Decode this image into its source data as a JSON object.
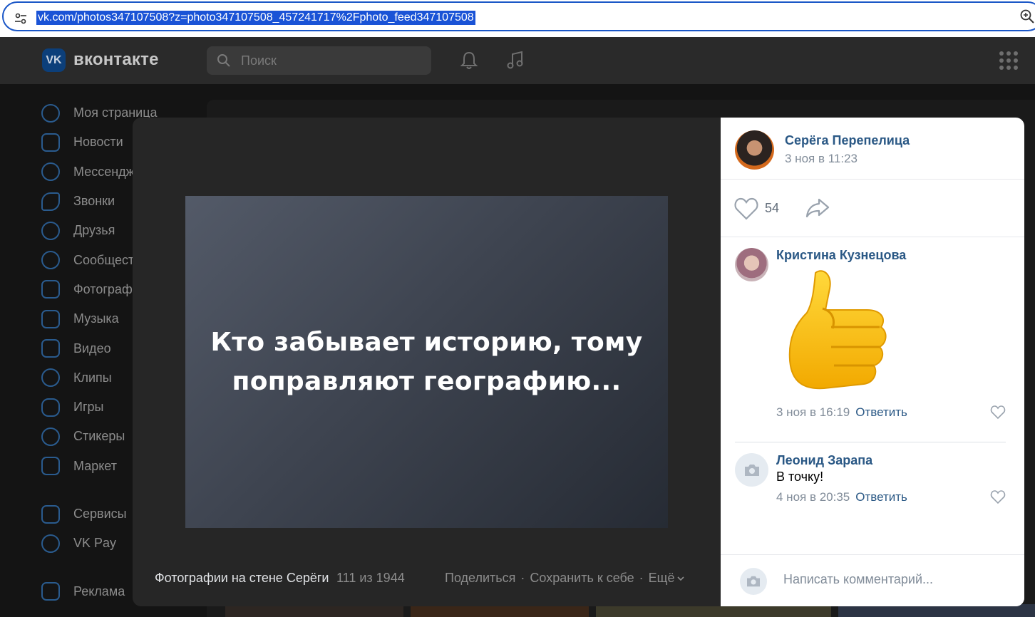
{
  "browser": {
    "url": "vk.com/photos347107508?z=photo347107508_457241717%2Fphoto_feed347107508"
  },
  "vk": {
    "logo_text": "VK",
    "wordmark": "вконтакте",
    "search_placeholder": "Поиск",
    "nav": [
      {
        "label": "Моя страница",
        "icon": "user-circle-icon"
      },
      {
        "label": "Новости",
        "icon": "news-icon"
      },
      {
        "label": "Мессенджер",
        "icon": "message-icon"
      },
      {
        "label": "Звонки",
        "icon": "phone-icon"
      },
      {
        "label": "Друзья",
        "icon": "friends-icon"
      },
      {
        "label": "Сообщества",
        "icon": "communities-icon"
      },
      {
        "label": "Фотографии",
        "icon": "photos-icon"
      },
      {
        "label": "Музыка",
        "icon": "music-icon"
      },
      {
        "label": "Видео",
        "icon": "video-icon"
      },
      {
        "label": "Клипы",
        "icon": "clips-icon"
      },
      {
        "label": "Игры",
        "icon": "games-icon"
      },
      {
        "label": "Стикеры",
        "icon": "stickers-icon"
      },
      {
        "label": "Маркет",
        "icon": "market-icon"
      },
      {
        "label": "Сервисы",
        "icon": "services-icon"
      },
      {
        "label": "VK Pay",
        "icon": "vkpay-icon"
      },
      {
        "label": "Реклама",
        "icon": "ads-icon"
      }
    ]
  },
  "viewer": {
    "photo_text": "Кто забывает историю, тому поправляют географию...",
    "album_label": "Фотографии на стене Серёги",
    "counter": "111 из 1944",
    "share_label": "Поделиться",
    "save_label": "Сохранить к себе",
    "more_label": "Ещё",
    "author": {
      "name": "Серёга Перепелица",
      "date": "3 ноя в 11:23"
    },
    "likes": "54",
    "comments": [
      {
        "name": "Кристина Кузнецова",
        "text": "",
        "sticker": "thumbs-up",
        "date": "3 ноя в 16:19",
        "reply": "Ответить"
      },
      {
        "name": "Леонид Зарапа",
        "text": "В точку!",
        "date": "4 ноя в 20:35",
        "reply": "Ответить"
      }
    ],
    "comment_placeholder": "Написать комментарий..."
  }
}
